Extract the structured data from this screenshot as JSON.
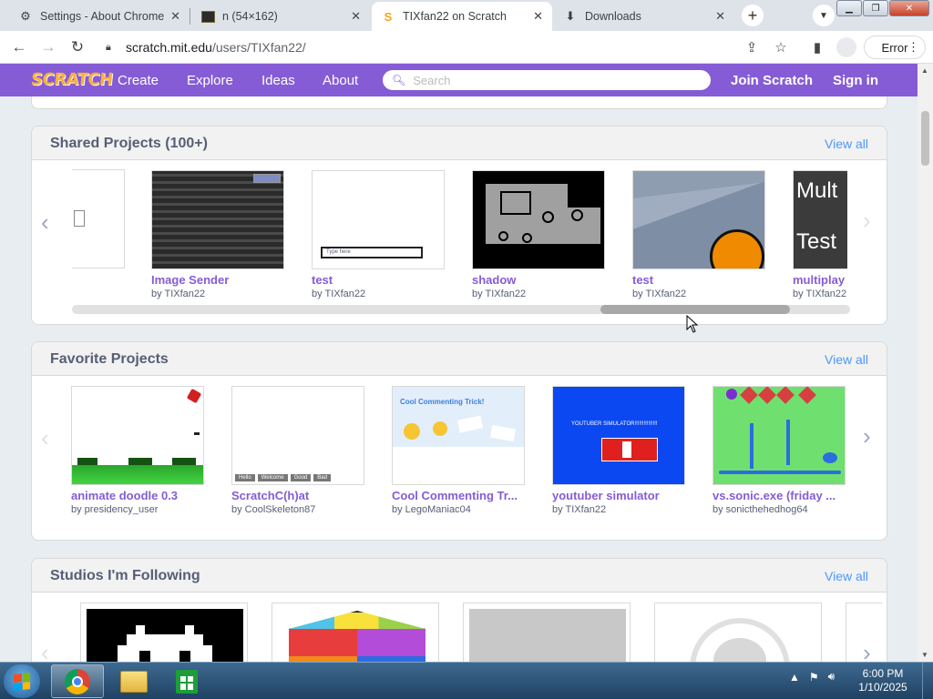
{
  "browser": {
    "tabs": [
      {
        "title": "Settings - About Chrome",
        "icon": "gear-icon"
      },
      {
        "title": "n (54×162)",
        "icon": "image-icon"
      },
      {
        "title": "TIXfan22 on Scratch",
        "icon": "scratch-icon"
      },
      {
        "title": "Downloads",
        "icon": "download-icon"
      }
    ],
    "url_domain": "scratch.mit.edu",
    "url_path": "/users/TIXfan22/",
    "error_label": "Error"
  },
  "scratch_nav": {
    "logo": "SCRATCH",
    "create": "Create",
    "explore": "Explore",
    "ideas": "Ideas",
    "about": "About",
    "search_placeholder": "Search",
    "join": "Join Scratch",
    "signin": "Sign in"
  },
  "shared": {
    "title": "Shared Projects (100+)",
    "view_all": "View all",
    "projects": [
      {
        "title": "Image Sender",
        "by": "by TIXfan22"
      },
      {
        "title": "test",
        "by": "by TIXfan22",
        "thumb_text": "Type here"
      },
      {
        "title": "shadow",
        "by": "by TIXfan22"
      },
      {
        "title": "test",
        "by": "by TIXfan22"
      },
      {
        "title": "multiplay",
        "by": "by TIXfan22",
        "thumb_text_1": "Mult",
        "thumb_text_2": "Test"
      }
    ]
  },
  "favorites": {
    "title": "Favorite Projects",
    "view_all": "View all",
    "projects": [
      {
        "title": "animate doodle 0.3",
        "by": "by presidency_user"
      },
      {
        "title": "ScratchC(h)at",
        "by": "by CoolSkeleton87",
        "thumb_buttons": [
          "Hello",
          "Welcome",
          "Good",
          "Bad"
        ]
      },
      {
        "title": "Cool Commenting Tr...",
        "by": "by LegoManiac04",
        "thumb_heading": "Cool Commenting Trick!"
      },
      {
        "title": "youtuber simulator",
        "by": "by TIXfan22",
        "thumb_heading": "YOUTUBER SIMULATOR!!!!!!!!!!!!!!!"
      },
      {
        "title": "vs.sonic.exe (friday ...",
        "by": "by sonicthehedhog64"
      }
    ]
  },
  "studios": {
    "title": "Studios I'm Following",
    "view_all": "View all"
  },
  "taskbar": {
    "time": "6:00 PM",
    "date": "1/10/2025"
  },
  "colors": {
    "scratch_purple": "#855cd6",
    "link_blue": "#4c97ff"
  }
}
